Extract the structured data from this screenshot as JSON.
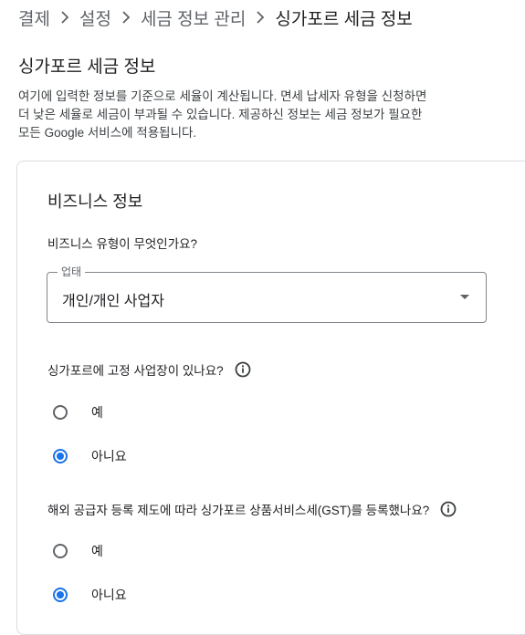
{
  "breadcrumb": {
    "items": [
      "결제",
      "설정",
      "세금 정보 관리",
      "싱가포르 세금 정보"
    ]
  },
  "page": {
    "title": "싱가포르 세금 정보",
    "description_line1": "여기에 입력한 정보를 기준으로 세율이 계산됩니다. 면세 납세자 유형을 신청하면",
    "description_line2": "더 낮은 세율로 세금이 부과될 수 있습니다. 제공하신 정보는 세금 정보가 필요한",
    "description_line3": "모든 Google 서비스에 적용됩니다."
  },
  "business_section": {
    "title": "비즈니스 정보",
    "business_type_question": "비즈니스 유형이 무엇인가요?",
    "business_type_select": {
      "label": "업태",
      "value": "개인/개인 사업자"
    },
    "fixed_establishment": {
      "question": "싱가포르에 고정 사업장이 있나요?",
      "options": [
        {
          "label": "예",
          "selected": false
        },
        {
          "label": "아니요",
          "selected": true
        }
      ]
    },
    "gst_registration": {
      "question": "해외 공급자 등록 제도에 따라 싱가포르 상품서비스세(GST)를 등록했나요?",
      "options": [
        {
          "label": "예",
          "selected": false
        },
        {
          "label": "아니요",
          "selected": true
        }
      ]
    }
  },
  "colors": {
    "accent": "#1a73e8",
    "text_primary": "#202124",
    "text_secondary": "#5f6368",
    "border": "#dadce0"
  },
  "icons": {
    "breadcrumb_separator": "chevron-right-icon",
    "help": "info-icon",
    "dropdown": "arrow-drop-down-icon"
  }
}
